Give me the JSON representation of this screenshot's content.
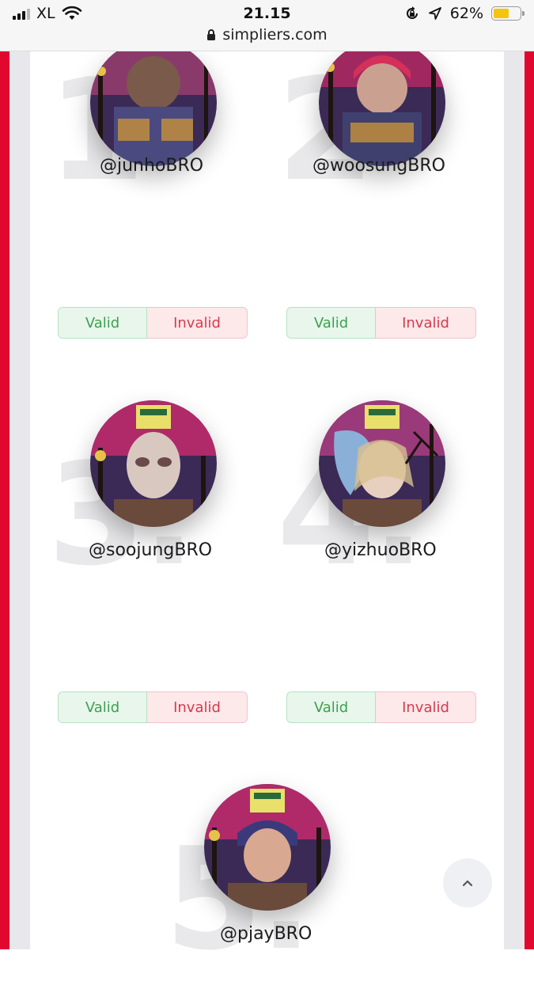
{
  "status_bar": {
    "carrier": "XL",
    "time": "21.15",
    "url": "simpliers.com",
    "battery_percent": "62%",
    "battery_level": 0.62,
    "icons": [
      "signal-icon",
      "wifi-icon",
      "lock-icon",
      "rotation-lock-icon",
      "location-arrow-icon",
      "battery-icon"
    ]
  },
  "colors": {
    "frame_red": "#e1082f",
    "valid_green": "#3aa24e",
    "invalid_red": "#d73a4e",
    "battery_yellow": "#f5c40e"
  },
  "entries": [
    {
      "rank": "1",
      "handle": "@junhoBRO",
      "valid_label": "Valid",
      "invalid_label": "Invalid"
    },
    {
      "rank": "2",
      "handle": "@woosungBRO",
      "valid_label": "Valid",
      "invalid_label": "Invalid"
    },
    {
      "rank": "3.",
      "handle": "@soojungBRO",
      "valid_label": "Valid",
      "invalid_label": "Invalid"
    },
    {
      "rank": "4.",
      "handle": "@yizhuoBRO",
      "valid_label": "Valid",
      "invalid_label": "Invalid"
    },
    {
      "rank": "5.",
      "handle": "@pjayBRO"
    }
  ],
  "scroll_top_icon": "chevron-up-icon"
}
